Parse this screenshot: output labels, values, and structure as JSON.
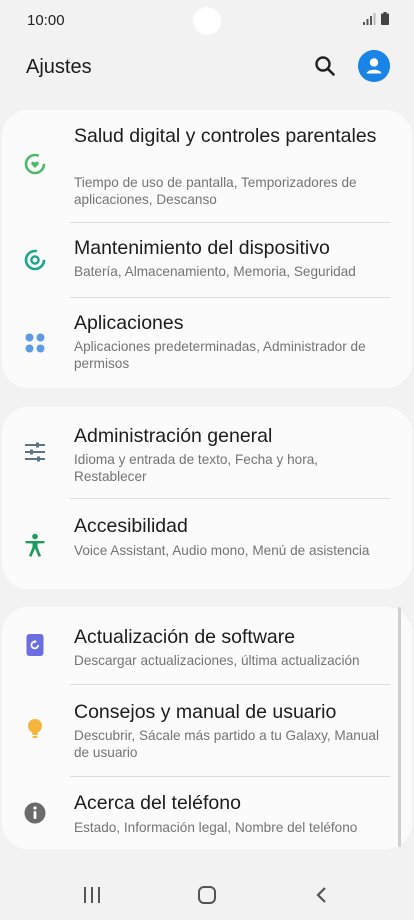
{
  "status_bar": {
    "time": "10:00"
  },
  "header": {
    "title": "Ajustes"
  },
  "sections": [
    {
      "items": [
        {
          "title": "Salud digital y controles parentales",
          "subtitle": "Tiempo de uso de pantalla, Temporizadores de aplicaciones, Descanso",
          "icon": "digital-wellbeing-icon"
        },
        {
          "title": "Mantenimiento del dispositivo",
          "subtitle": "Batería, Almacenamiento, Memoria, Seguridad",
          "icon": "device-care-icon"
        },
        {
          "title": "Aplicaciones",
          "subtitle": "Aplicaciones predeterminadas, Administrador de permisos",
          "icon": "apps-icon"
        }
      ]
    },
    {
      "items": [
        {
          "title": "Administración general",
          "subtitle": "Idioma y entrada de texto, Fecha y hora, Restablecer",
          "icon": "general-management-icon"
        },
        {
          "title": "Accesibilidad",
          "subtitle": "Voice Assistant, Audio mono, Menú de asistencia",
          "icon": "accessibility-icon"
        }
      ]
    },
    {
      "items": [
        {
          "title": "Actualización de software",
          "subtitle": "Descargar actualizaciones, última actualización",
          "icon": "software-update-icon"
        },
        {
          "title": "Consejos y manual de usuario",
          "subtitle": "Descubrir, Sácale más partido a tu Galaxy, Manual de usuario",
          "icon": "tips-icon"
        },
        {
          "title": "Acerca del teléfono",
          "subtitle": "Estado, Información legal, Nombre del teléfono",
          "icon": "info-icon"
        }
      ]
    }
  ],
  "colors": {
    "background": "#f2f2f2",
    "card": "#fbfbfb",
    "accent_blue": "#1a84e6",
    "wellbeing_green": "#4cb86a",
    "device_care_teal": "#1aa58e",
    "apps_blue": "#5b9be6",
    "general_slate": "#5c7488",
    "accessibility_green": "#1f9a5f",
    "update_purple": "#6b6ee0",
    "tips_yellow": "#f5b53a",
    "info_gray": "#6a6a6a"
  }
}
